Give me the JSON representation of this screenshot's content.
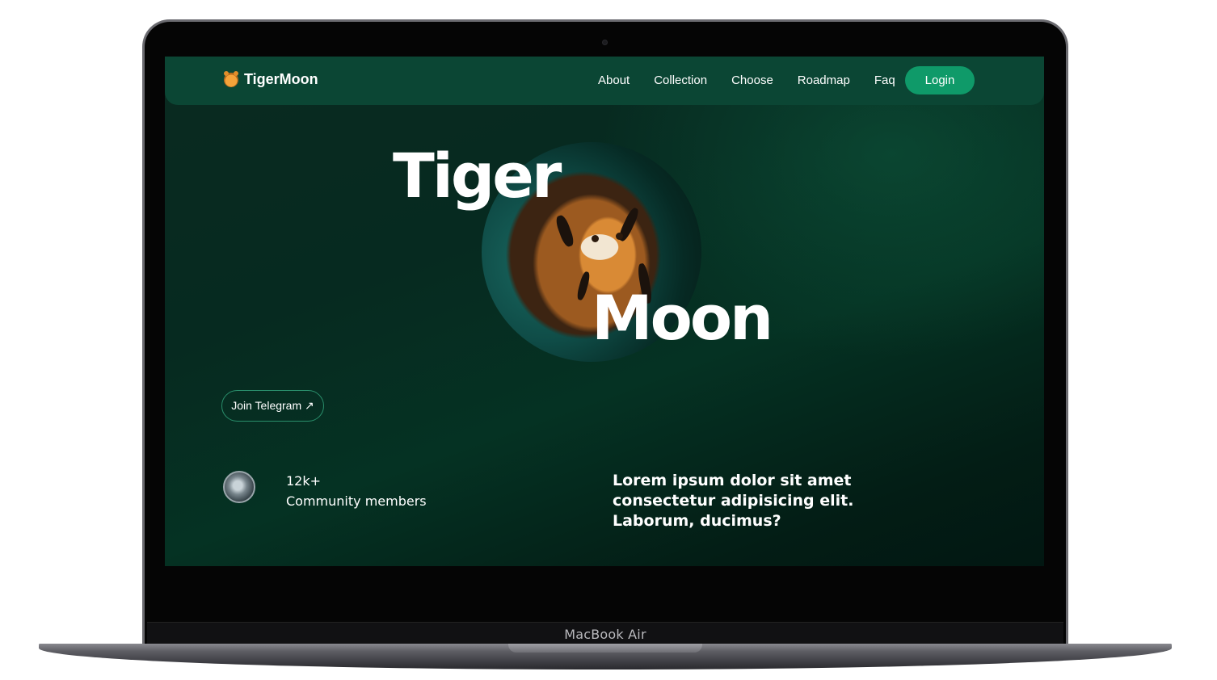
{
  "navbar": {
    "logo_text": "TigerMoon",
    "links": [
      "About",
      "Collection",
      "Choose",
      "Roadmap",
      "Faq"
    ],
    "login_label": "Login"
  },
  "hero": {
    "word_top": "Tiger",
    "word_bottom": "Moon",
    "telegram_label": "Join Telegram ↗"
  },
  "stats": {
    "value": "12k+",
    "label": "Community members"
  },
  "tagline": "Lorem ipsum dolor sit amet consectetur adipisicing elit. Laborum, ducimus?",
  "device": {
    "brand_text": "MacBook Air"
  },
  "colors": {
    "accent": "#0f9a69",
    "navbar": "#0b4634",
    "background": "#05271c"
  },
  "icons": {
    "logo": "tiger-head-icon",
    "telegram_arrow": "arrow-up-right-icon"
  }
}
